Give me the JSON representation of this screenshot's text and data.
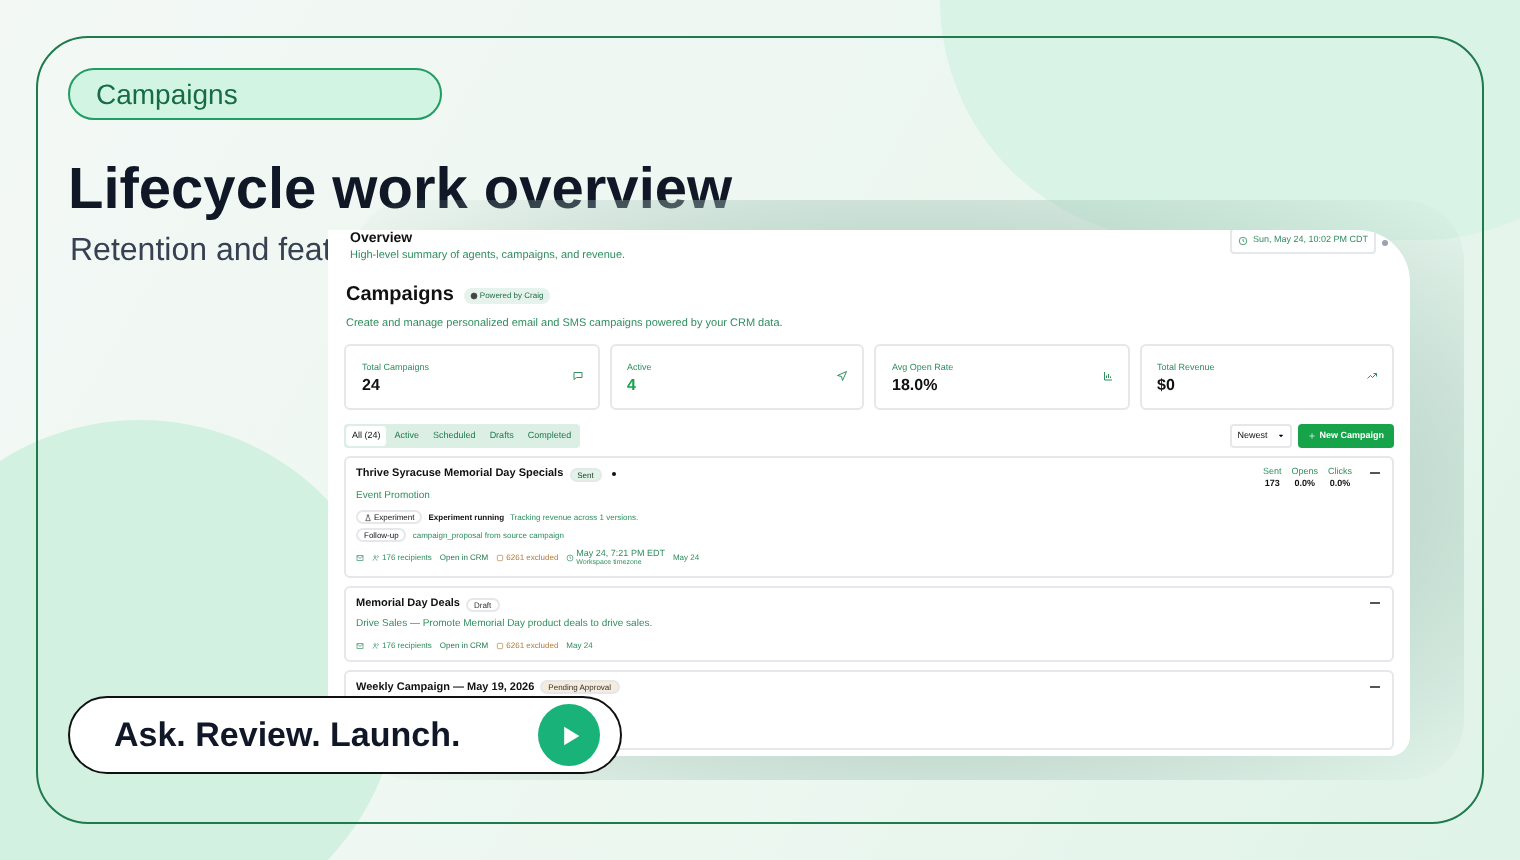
{
  "badge": "Campaigns",
  "headline": "Lifecycle work overview",
  "subheadline": "Retention and feat",
  "screenshot": {
    "page_title": "Overview",
    "page_subtitle": "High-level summary of agents, campaigns, and revenue.",
    "local_time": "Sun, May 24, 10:02 PM CDT",
    "section_title": "Campaigns",
    "powered_badge": "Powered by Craig",
    "description": "Create and manage personalized email and SMS campaigns powered by your CRM data.",
    "stats": [
      {
        "label": "Total Campaigns",
        "value": "24",
        "accent": false,
        "kind": "chat"
      },
      {
        "label": "Active",
        "value": "4",
        "accent": true,
        "kind": "send"
      },
      {
        "label": "Avg Open Rate",
        "value": "18.0%",
        "accent": false,
        "kind": "chart"
      },
      {
        "label": "Total Revenue",
        "value": "$0",
        "accent": false,
        "kind": "trend"
      }
    ],
    "tabs": [
      {
        "label": "All (24)",
        "selected": true
      },
      {
        "label": "Active",
        "selected": false
      },
      {
        "label": "Scheduled",
        "selected": false
      },
      {
        "label": "Drafts",
        "selected": false
      },
      {
        "label": "Completed",
        "selected": false
      }
    ],
    "sort": "Newest",
    "new_button": "New Campaign",
    "campaigns": [
      {
        "title": "Thrive Syracuse Memorial Day Specials",
        "status": "Sent",
        "color": "#dff5e8",
        "subtitle": "Event Promotion",
        "experiment": {
          "chip": "Experiment",
          "state": "Experiment running",
          "note": "Tracking revenue across 1 versions."
        },
        "follow_up": {
          "chip": "Follow-up",
          "note": "campaign_proposal from source campaign"
        },
        "meta": {
          "recipients": "176 recipients",
          "crm": "Open in CRM",
          "excluded": "6261 excluded",
          "schedule": "May 24, 7:21 PM EDT",
          "timezone": "Workspace timezone",
          "date": "May 24"
        },
        "metrics": [
          {
            "label": "Sent",
            "value": "173"
          },
          {
            "label": "Opens",
            "value": "0.0%"
          },
          {
            "label": "Clicks",
            "value": "0.0%"
          }
        ]
      },
      {
        "title": "Memorial Day Deals",
        "status": "Draft",
        "color": "#ffffff",
        "subtitle": "Drive Sales — Promote Memorial Day product deals to drive sales.",
        "meta": {
          "recipients": "176 recipients",
          "crm": "Open in CRM",
          "excluded": "6261 excluded",
          "date": "May 24"
        }
      },
      {
        "title": "Weekly Campaign — May 19, 2026",
        "status": "Pending Approval",
        "color": "#f5ecdc"
      }
    ]
  },
  "cta": "Ask. Review. Launch."
}
